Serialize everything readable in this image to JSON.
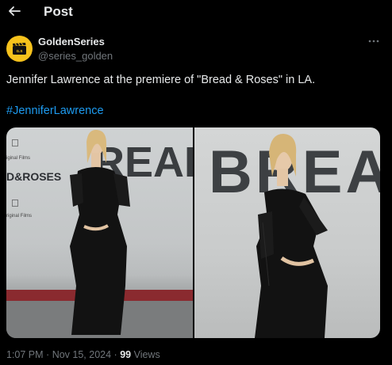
{
  "header": {
    "title": "Post"
  },
  "author": {
    "name": "GoldenSeries",
    "handle": "@series_golden"
  },
  "tweet": {
    "text": "Jennifer Lawrence at the premiere of \"Bread & Roses\" in LA.",
    "hashtag": "#JenniferLawrence"
  },
  "media": {
    "photo1": {
      "backdrop_text_1": "D&ROSES",
      "logo_text_1": "iginal Films",
      "logo_text_2": "riginal Films",
      "big_letters": "READ"
    },
    "photo2": {
      "big_letters": "BREAD"
    }
  },
  "meta": {
    "time": "1:07 PM",
    "date": "Nov 15, 2024",
    "views_count": "99",
    "views_label": "Views"
  },
  "colors": {
    "accent": "#1d9bf0",
    "secondary_text": "#71767b",
    "avatar_bg": "#f6c21c"
  }
}
